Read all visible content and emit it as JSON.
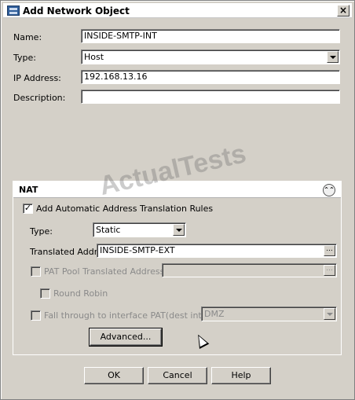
{
  "window": {
    "title": "Add Network Object",
    "close_glyph": "×",
    "icon": "network-object-icon"
  },
  "form": {
    "name_label": "Name:",
    "name_value": "INSIDE-SMTP-INT",
    "type_label": "Type:",
    "type_value": "Host",
    "ip_label": "IP Address:",
    "ip_value": "192.168.13.16",
    "description_label": "Description:",
    "description_value": ""
  },
  "nat": {
    "title": "NAT",
    "collapse_glyph": "⌃⌃",
    "auto_rules_label": "Add Automatic Address Translation Rules",
    "auto_rules_checked": true,
    "type_label": "Type:",
    "type_value": "Static",
    "translated_label": "Translated Addr:",
    "translated_value": "INSIDE-SMTP-EXT",
    "pat_pool_label": "PAT Pool Translated Address:",
    "pat_pool_value": "",
    "round_robin_label": "Round Robin",
    "fallthrough_label": "Fall through to interface PAT(dest intf):",
    "fallthrough_value": "DMZ",
    "advanced_label": "Advanced..."
  },
  "buttons": {
    "ok": "OK",
    "cancel": "Cancel",
    "help": "Help"
  },
  "watermark": "ActualTests",
  "ellipsis": "..."
}
